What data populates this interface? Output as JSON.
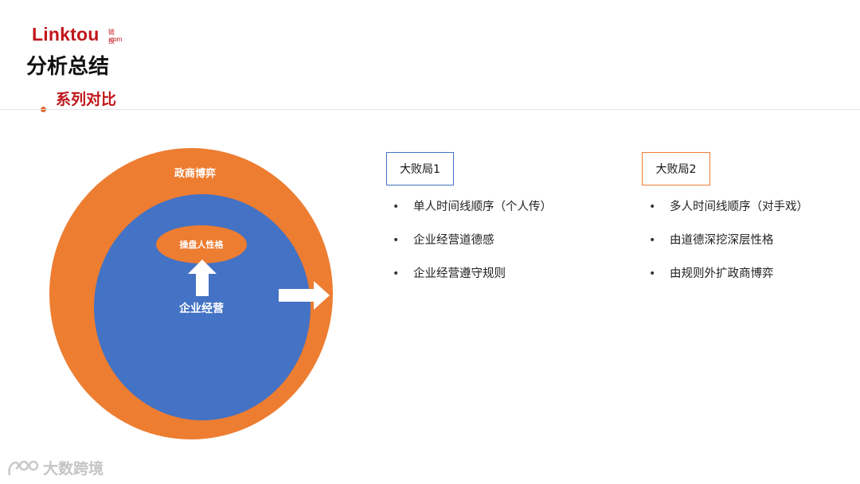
{
  "brand": {
    "logo_text": "Linktou",
    "logo_cn": "链投",
    "logo_suffix": ".com",
    "accent_color": "#c0171c"
  },
  "header": {
    "title": "分析总结",
    "subtitle": "系列对比"
  },
  "diagram": {
    "outer_label": "政商博弈",
    "inner_label": "企业经营",
    "oval_label": "操盘人性格",
    "outer_color": "#ed7d31",
    "inner_color": "#4472c4",
    "icons": [
      "up-arrow-icon",
      "right-arrow-icon"
    ]
  },
  "columns": [
    {
      "title": "大败局1",
      "border_color": "#4472c4",
      "items": [
        "单人时间线顺序（个人传）",
        "企业经营道德感",
        "企业经营遵守规则"
      ]
    },
    {
      "title": "大败局2",
      "border_color": "#ed7d31",
      "items": [
        "多人时间线顺序（对手戏）",
        "由道德深挖深层性格",
        "由规则外扩政商博弈"
      ]
    }
  ],
  "watermark": {
    "text": "大数跨境",
    "icon": "watermark-logo-icon"
  }
}
